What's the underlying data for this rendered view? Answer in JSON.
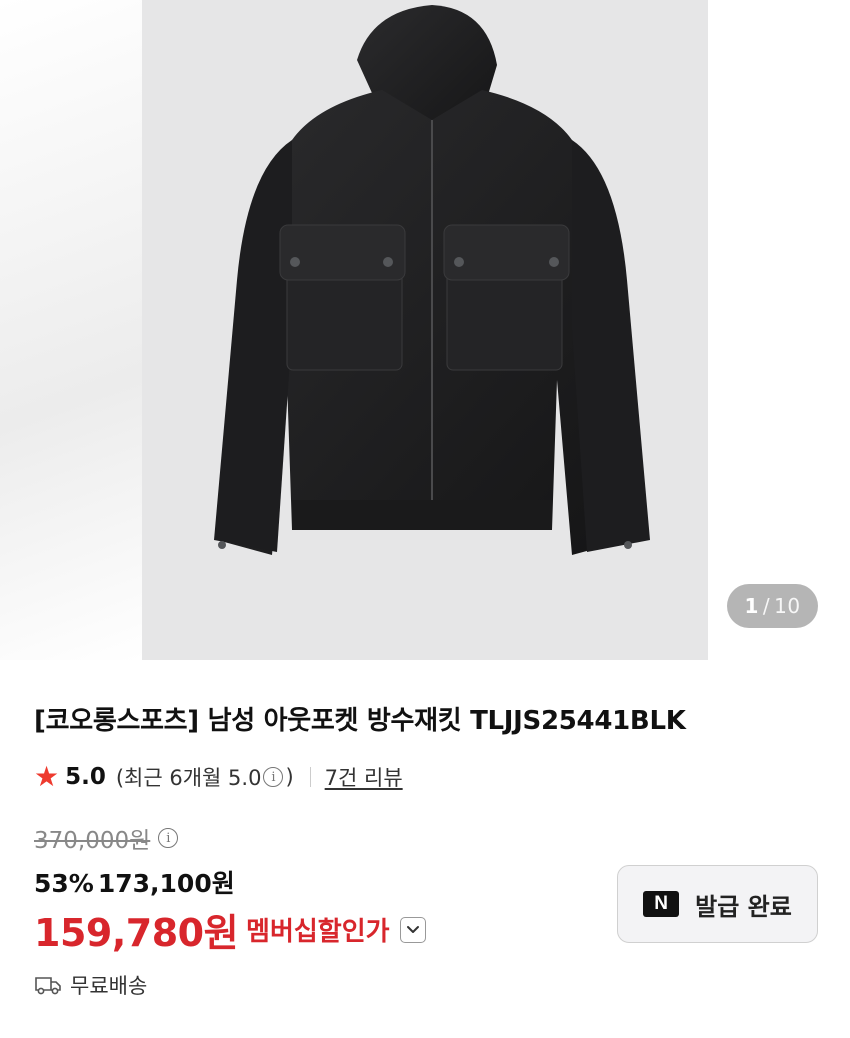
{
  "gallery": {
    "current": "1",
    "separator": "/",
    "total": "10"
  },
  "product": {
    "title": "[코오롱스포츠] 남성 아웃포켓 방수재킷 TLJJS25441BLK"
  },
  "rating": {
    "star": "★",
    "score": "5.0",
    "recent_prefix": "(최근 6개월 5.0",
    "recent_suffix": ")",
    "info_glyph": "i",
    "review_link": "7건 리뷰"
  },
  "price": {
    "original": "370,000원",
    "discount_percent": "53%",
    "sale_price": "173,100원",
    "member_price": "159,780원",
    "member_label": "멤버십할인가"
  },
  "coupon": {
    "icon_letter": "N",
    "label": "발급 완료"
  },
  "shipping": {
    "label": "무료배송"
  },
  "colors": {
    "accent_red": "#d8262c",
    "star_red": "#ee3a2e",
    "photo_background": "#e6e6e7"
  }
}
